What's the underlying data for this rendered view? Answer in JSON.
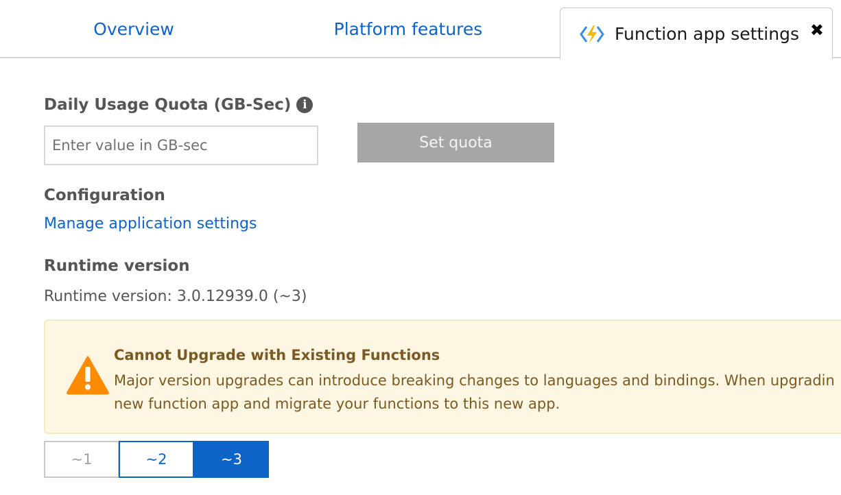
{
  "tabs": {
    "overview": "Overview",
    "platform_features": "Platform features",
    "function_app_settings": "Function app settings"
  },
  "quota": {
    "title": "Daily Usage Quota (GB-Sec)",
    "input_placeholder": "Enter value in GB-sec",
    "input_value": "",
    "set_button": "Set quota"
  },
  "configuration": {
    "title": "Configuration",
    "link": "Manage application settings"
  },
  "runtime": {
    "title": "Runtime version",
    "text": "Runtime version: 3.0.12939.0 (~3)"
  },
  "warning": {
    "title": "Cannot Upgrade with Existing Functions",
    "line1": "Major version upgrades can introduce breaking changes to languages and bindings. When upgradin",
    "line2": "new function app and migrate your functions to this new app."
  },
  "versions": {
    "options": [
      "~1",
      "~2",
      "~3"
    ],
    "selected": "~3"
  },
  "colors": {
    "link_blue": "#0e63c9",
    "warning_bg": "#fdf6e2",
    "warning_text": "#7a5a22",
    "warning_icon": "#ff8c00",
    "disabled_button": "#a6a6a6"
  },
  "icons": {
    "tab_icon": "function-lightning-icon",
    "close": "close-icon",
    "info": "info-icon",
    "warning": "warning-triangle-icon"
  }
}
